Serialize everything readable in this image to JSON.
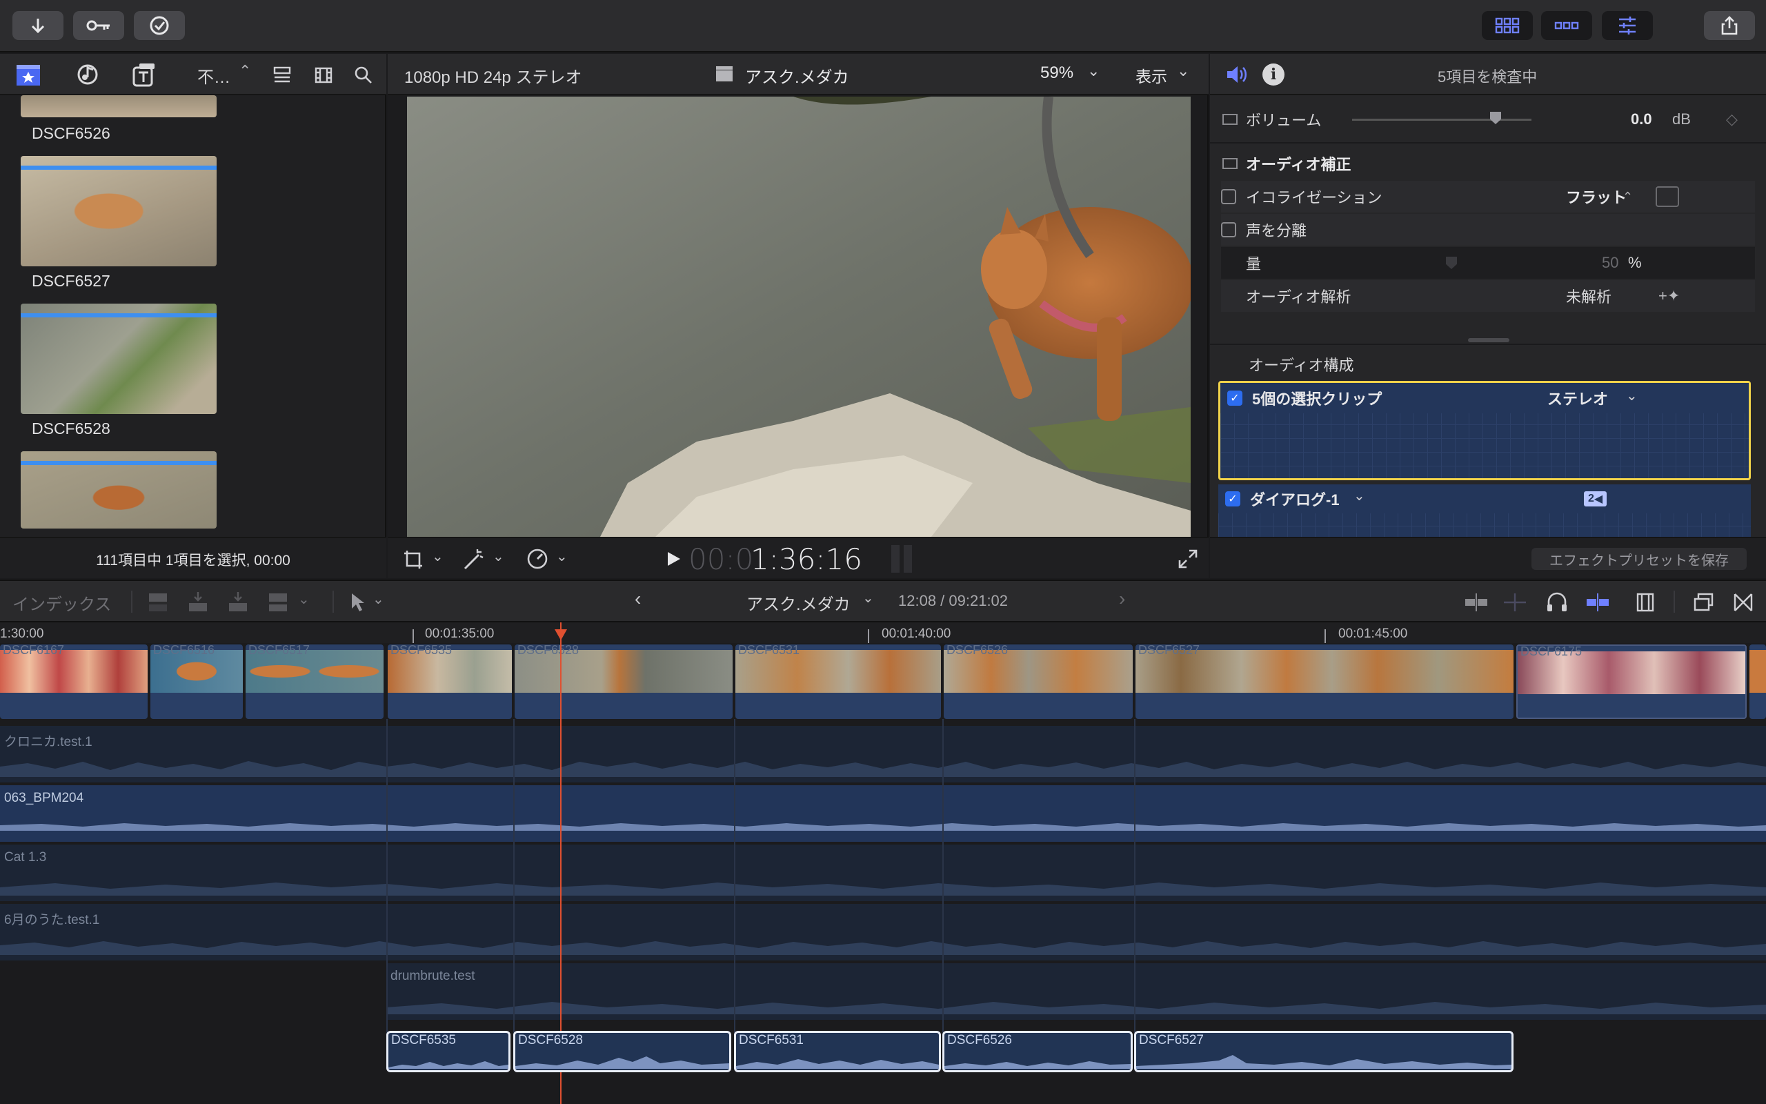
{
  "toolbar": {
    "import_icon": "arrow-down-icon",
    "keyword_icon": "key-icon",
    "analyze_icon": "checkmark-circle-icon",
    "right_icons": [
      "grid-browser-icon",
      "timeline-layout-icon",
      "inspector-sliders-icon",
      "share-icon"
    ]
  },
  "browser": {
    "filter_label": "不…",
    "status": "111項目中 1項目を選択, 00:00",
    "clips": [
      {
        "name": "DSCF6526"
      },
      {
        "name": "DSCF6527"
      },
      {
        "name": "DSCF6528"
      },
      {
        "name": ""
      }
    ]
  },
  "viewer": {
    "format": "1080p HD 24p ステレオ",
    "project": "アスク.メダカ",
    "zoom": "59%",
    "view_menu": "表示",
    "timecode_dim": "00:0",
    "timecode": "1:36:16"
  },
  "inspector": {
    "header": "5項目を検査中",
    "volume": {
      "label": "ボリューム",
      "value": "0.0",
      "unit": "dB"
    },
    "enhance": {
      "title": "オーディオ補正",
      "eq_label": "イコライゼーション",
      "eq_value": "フラット",
      "voice_label": "声を分離",
      "amount_label": "量",
      "amount_value": "50",
      "amount_unit": "%",
      "analysis_label": "オーディオ解析",
      "analysis_value": "未解析"
    },
    "config": {
      "title": "オーディオ構成",
      "row1_label": "5個の選択クリップ",
      "row1_value": "ステレオ",
      "row2_label": "ダイアログ-1",
      "row2_badge": "2"
    },
    "save_preset": "エフェクトプリセットを保存"
  },
  "timeline_header": {
    "index": "インデックス",
    "project": "アスク.メダカ",
    "duration": "12:08 / 09:21:02"
  },
  "ruler": [
    "1:30:00",
    "00:01:35:00",
    "00:01:40:00",
    "00:01:45:00"
  ],
  "primary_clips": [
    "DSCF6167",
    "DSCF6516",
    "DSCF6517",
    "DSCF6535",
    "DSCF6528",
    "DSCF6531",
    "DSCF6526",
    "DSCF6527",
    "DSCF6175"
  ],
  "audio_tracks": [
    "クロニカ.test.1",
    "063_BPM204",
    "Cat 1.3",
    "6月のうた.test.1",
    "drumbrute.test"
  ],
  "selected_clips": [
    "DSCF6535",
    "DSCF6528",
    "DSCF6531",
    "DSCF6526",
    "DSCF6527"
  ],
  "colors": {
    "accent": "#5e7cf0",
    "selection": "#f0d24a",
    "playhead": "#e05030",
    "clip": "#2a3f66"
  }
}
